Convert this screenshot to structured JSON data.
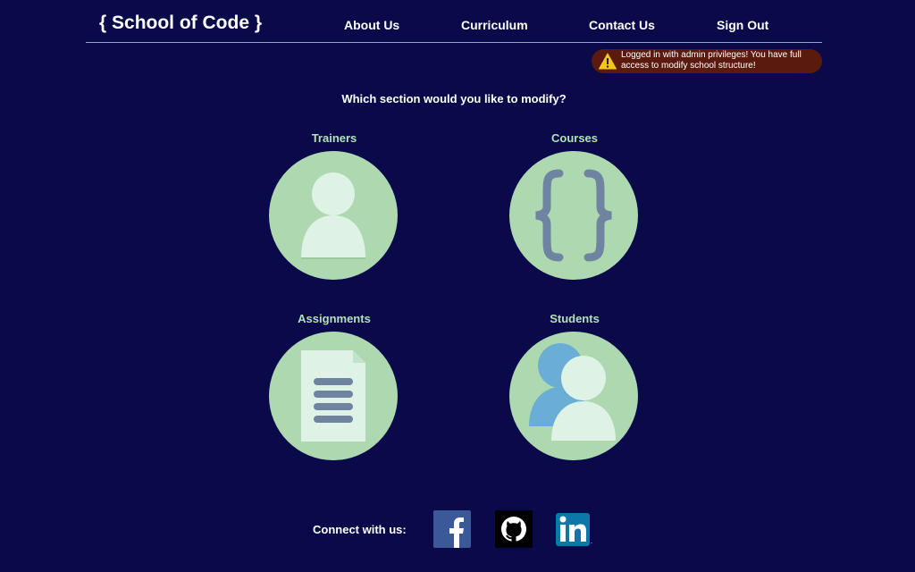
{
  "header": {
    "brand": "{ School of Code }",
    "nav": [
      {
        "label": "About Us"
      },
      {
        "label": "Curriculum"
      },
      {
        "label": "Contact Us"
      },
      {
        "label": "Sign Out"
      }
    ]
  },
  "alert": {
    "icon": "warning-icon",
    "text": "Logged in with admin privileges! You have full access to modify school structure!"
  },
  "prompt": "Which section would you like to modify?",
  "sections": [
    {
      "title": "Trainers",
      "icon": "person-icon"
    },
    {
      "title": "Courses",
      "icon": "curly-braces-icon"
    },
    {
      "title": "Assignments",
      "icon": "document-icon"
    },
    {
      "title": "Students",
      "icon": "people-icon"
    }
  ],
  "footer": {
    "connect_label": "Connect with us:",
    "social": [
      {
        "name": "facebook-icon"
      },
      {
        "name": "github-icon"
      },
      {
        "name": "linkedin-icon"
      }
    ]
  },
  "colors": {
    "background": "#0a0a4a",
    "card_title": "#b3e0b8",
    "circle": "#aed9b0",
    "alert_background": "#5a1a0e"
  }
}
